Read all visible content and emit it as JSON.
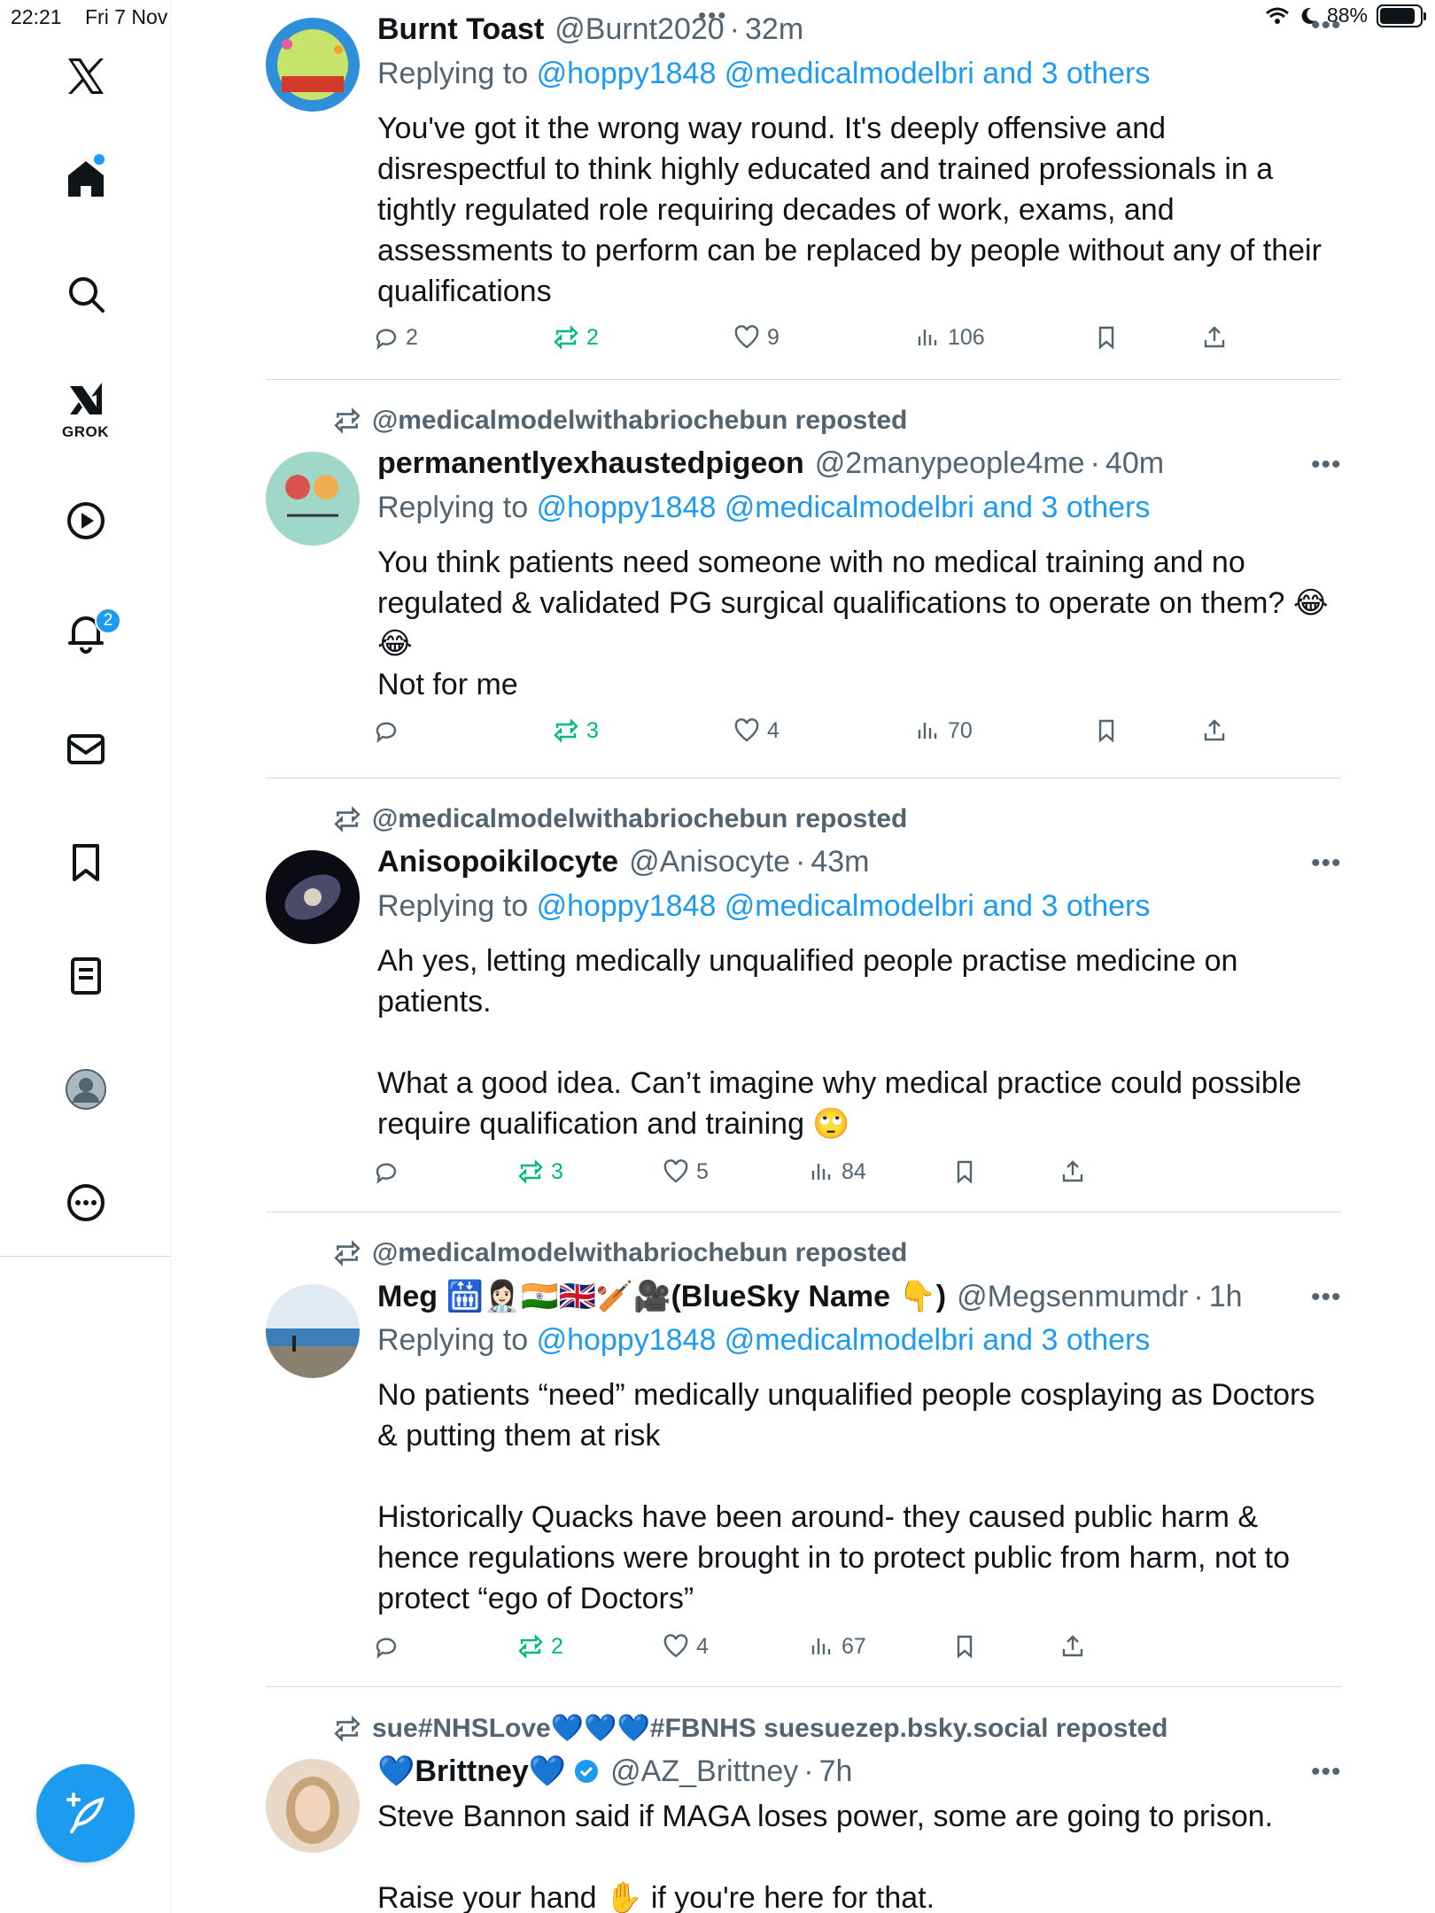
{
  "status_bar": {
    "time": "22:21",
    "date": "Fri 7 Nov",
    "battery": "88%",
    "battery_level": 0.88
  },
  "sidebar": {
    "grok_label": "GROK",
    "notifications_badge": "2"
  },
  "colors": {
    "accent": "#1d9bf0",
    "repost_green": "#00ba7c",
    "muted": "#536471",
    "text": "#0f1419"
  },
  "posts": [
    {
      "repost_by": "",
      "name": "Burnt Toast",
      "handle": "@Burnt2020",
      "time": "32m",
      "reply_prefix": "Replying to",
      "reply_targets": "@hoppy1848 @medicalmodelbri and 3 others",
      "body": [
        "You've got it the wrong way round. It's deeply offensive and disrespectful to think highly educated and trained professionals in a tightly regulated role requiring decades of work, exams, and assessments to perform can be replaced by people without any of their qualifications"
      ],
      "replies": "2",
      "reposts": "2",
      "likes": "9",
      "views": "106"
    },
    {
      "repost_by": "@medicalmodelwithabriochebun reposted",
      "name": "permanentlyexhaustedpigeon",
      "handle": "@2manypeople4me",
      "time": "40m",
      "reply_prefix": "Replying to",
      "reply_targets": "@hoppy1848 @medicalmodelbri and 3 others",
      "body": [
        "You think patients need someone with no medical training and no regulated & validated PG surgical qualifications to operate on them? 😂😂",
        "Not for me"
      ],
      "replies": "",
      "reposts": "3",
      "likes": "4",
      "views": "70"
    },
    {
      "repost_by": "@medicalmodelwithabriochebun reposted",
      "name": "Anisopoikilocyte",
      "handle": "@Anisocyte",
      "time": "43m",
      "reply_prefix": "Replying to",
      "reply_targets": "@hoppy1848 @medicalmodelbri and 3 others",
      "body": [
        "Ah yes, letting medically unqualified people practise medicine on patients.",
        "",
        "What a good idea. Can’t imagine why medical practice could possible require qualification and training 🙄"
      ],
      "replies": "",
      "reposts": "3",
      "likes": "5",
      "views": "84"
    },
    {
      "repost_by": "@medicalmodelwithabriochebun reposted",
      "name": "Meg 🛗👩🏻‍⚕️🇮🇳🇬🇧🏏🎥(BlueSky Name 👇)",
      "handle": "@Megsenmumdr",
      "time": "1h",
      "reply_prefix": "Replying to",
      "reply_targets": "@hoppy1848 @medicalmodelbri and 3 others",
      "body": [
        "No patients “need” medically unqualified people cosplaying as Doctors & putting them at risk",
        "",
        "Historically Quacks have been around- they caused public harm & hence regulations were brought in to protect public from harm, not to protect “ego of Doctors”"
      ],
      "replies": "",
      "reposts": "2",
      "likes": "4",
      "views": "67"
    },
    {
      "repost_by": "sue#NHSLove💙💙💙#FBNHS suesuezep.bsky.social reposted",
      "name": "💙Brittney💙",
      "handle": "@AZ_Brittney",
      "time": "7h",
      "reply_prefix": "",
      "reply_targets": "",
      "body": [
        "Steve Bannon said if MAGA loses power, some are going to prison.",
        "",
        "Raise your hand ✋ if you're here for that."
      ],
      "replies": "",
      "reposts": "",
      "likes": "",
      "views": ""
    }
  ],
  "dot_sep": "·"
}
